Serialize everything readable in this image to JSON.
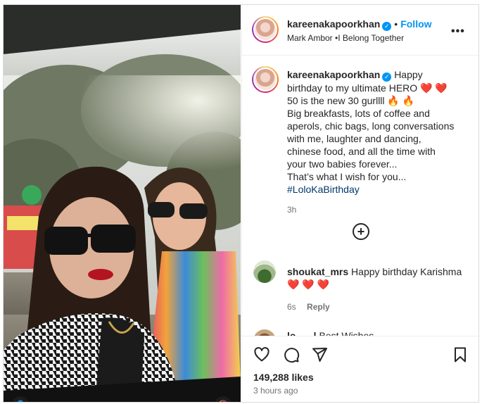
{
  "post": {
    "username": "kareenakapoorkhan",
    "follow_label": "Follow",
    "separator": "•",
    "audio": "Mark Ambor •I Belong Together",
    "more_label": "•••"
  },
  "caption": {
    "username": "kareenakapoorkhan",
    "line1": "Happy",
    "line2": "birthday to my ultimate HERO",
    "line3": "50 is the new 30 gurllll",
    "line4": "Big breakfasts, lots of coffee and",
    "line5": "aperols, chic bags, long conversations",
    "line6": "with me, laughter and dancing,",
    "line7": "chinese food, and all the time with",
    "line8": "your two babies forever...",
    "line9": "That’s what I wish for you...",
    "hashtag": "#LoloKaBirthday",
    "time": "3h",
    "hearts": "❤️ ❤️",
    "fires": "🔥 🔥"
  },
  "comments": [
    {
      "username": "shoukat_mrs",
      "text": "Happy birthday Karishma",
      "hearts": "❤️ ❤️ ❤️",
      "time": "6s",
      "reply_label": "Reply"
    },
    {
      "username": "lo         l",
      "text": "Best Wishes"
    }
  ],
  "footer": {
    "likes": "149,288 likes",
    "posted": "3 hours ago"
  },
  "icons": {
    "heart": "heart-icon",
    "comment": "comment-icon",
    "share": "share-icon",
    "save": "bookmark-icon",
    "more": "more-icon",
    "add_comment": "plus-circle-icon",
    "verified": "verified-icon"
  },
  "colors": {
    "link": "#0095f6",
    "hashtag": "#00376b",
    "muted": "#737373",
    "heart": "#ed1c24"
  }
}
